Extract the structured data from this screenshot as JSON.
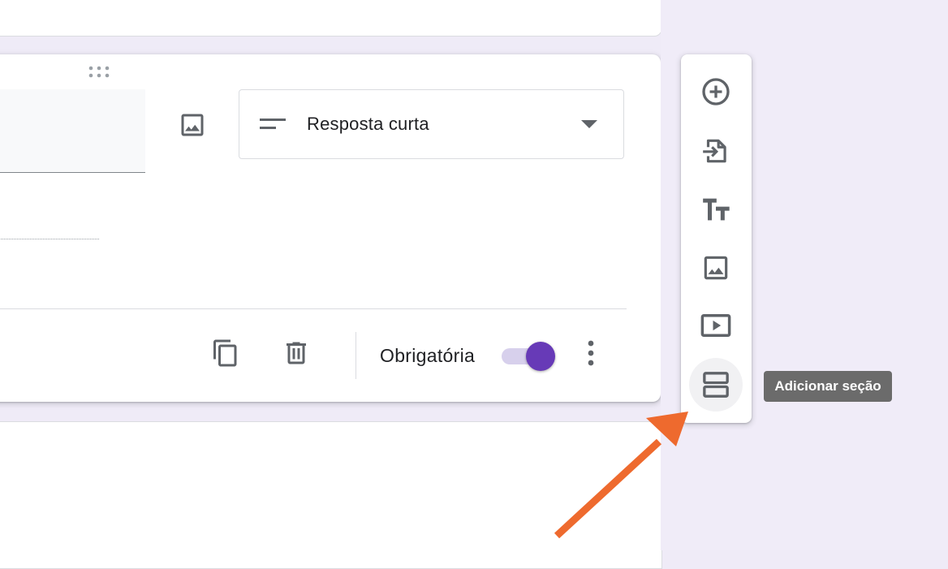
{
  "question": {
    "type_label": "Resposta curta",
    "required_label": "Obrigatória",
    "required_on": true
  },
  "toolbar": {
    "items": [
      {
        "name": "add-question",
        "icon": "plus-circle-icon"
      },
      {
        "name": "import-questions",
        "icon": "import-icon"
      },
      {
        "name": "add-title-description",
        "icon": "text-tt-icon"
      },
      {
        "name": "add-image",
        "icon": "image-icon"
      },
      {
        "name": "add-video",
        "icon": "video-icon"
      },
      {
        "name": "add-section",
        "icon": "section-icon"
      }
    ],
    "tooltip": "Adicionar seção"
  },
  "colors": {
    "accent": "#673ab7",
    "toggle_track": "#d7d0ec",
    "background": "#efebf7",
    "annotation_arrow": "#ee6a2e",
    "icon": "#5f6368"
  }
}
